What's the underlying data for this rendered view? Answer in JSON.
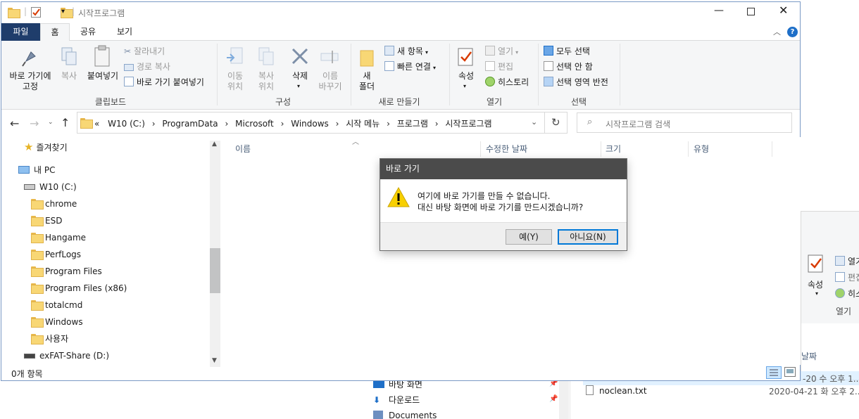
{
  "window": {
    "title": "시작프로그램"
  },
  "tabs": [
    {
      "label": "파일"
    },
    {
      "label": "홈"
    },
    {
      "label": "공유"
    },
    {
      "label": "보기"
    }
  ],
  "ribbon": {
    "clipboard": {
      "pin": "바로 가기에\n고정",
      "copy": "복사",
      "paste": "붙여넣기",
      "cut": "잘라내기",
      "copy_path": "경로 복사",
      "paste_shortcut": "바로 가기 붙여넣기",
      "group": "클립보드"
    },
    "organize": {
      "move_to": "이동\n위치",
      "copy_to": "복사\n위치",
      "delete": "삭제",
      "rename": "이름\n바꾸기",
      "group": "구성"
    },
    "new": {
      "new_folder": "새\n폴더",
      "new_item": "새 항목",
      "easy_access": "빠른 연결",
      "group": "새로 만들기"
    },
    "open": {
      "properties": "속성",
      "open": "열기",
      "edit": "편집",
      "history": "히스토리",
      "group": "열기"
    },
    "select": {
      "select_all": "모두 선택",
      "select_none": "선택 안 함",
      "invert": "선택 영역 반전",
      "group": "선택"
    }
  },
  "address": {
    "overflow": "«",
    "crumbs": [
      "W10 (C:)",
      "ProgramData",
      "Microsoft",
      "Windows",
      "시작 메뉴",
      "프로그램",
      "시작프로그램"
    ],
    "sep": "›",
    "search_placeholder": "시작프로그램 검색"
  },
  "nav": {
    "favorites": "즐겨찾기",
    "this_pc": "내 PC",
    "drive_c": "W10 (C:)",
    "folders": [
      "chrome",
      "ESD",
      "Hangame",
      "PerfLogs",
      "Program Files",
      "Program Files (x86)",
      "totalcmd",
      "Windows",
      "사용자"
    ],
    "drive_d": "exFAT-Share (D:)"
  },
  "columns": [
    "이름",
    "수정한 날짜",
    "크기",
    "유형"
  ],
  "status": {
    "count": "0개 항목"
  },
  "dialog": {
    "title": "바로 가기",
    "line1": "여기에 바로 가기를 만들 수 없습니다.",
    "line2": "대신 바탕 화면에 바로 가기를 만드시겠습니까?",
    "yes": "예(Y)",
    "no": "아니요(N)"
  },
  "background": {
    "properties": "속성",
    "open_short": "열기",
    "edit_short": "편집",
    "history_short": "히스토",
    "group_open": "열기",
    "col_date_short": "날짜",
    "row1_date": "-20 수 오후 1...",
    "file": "noclean.txt",
    "file_date": "2020-04-21 화 오후 2...",
    "nav_desktop": "바탕 화면",
    "nav_downloads": "다운로드",
    "nav_documents": "Documents"
  },
  "colors": {
    "file_tab": "#1f3d6b",
    "accent": "#0078d7",
    "dialog_title": "#4b4b4b"
  }
}
